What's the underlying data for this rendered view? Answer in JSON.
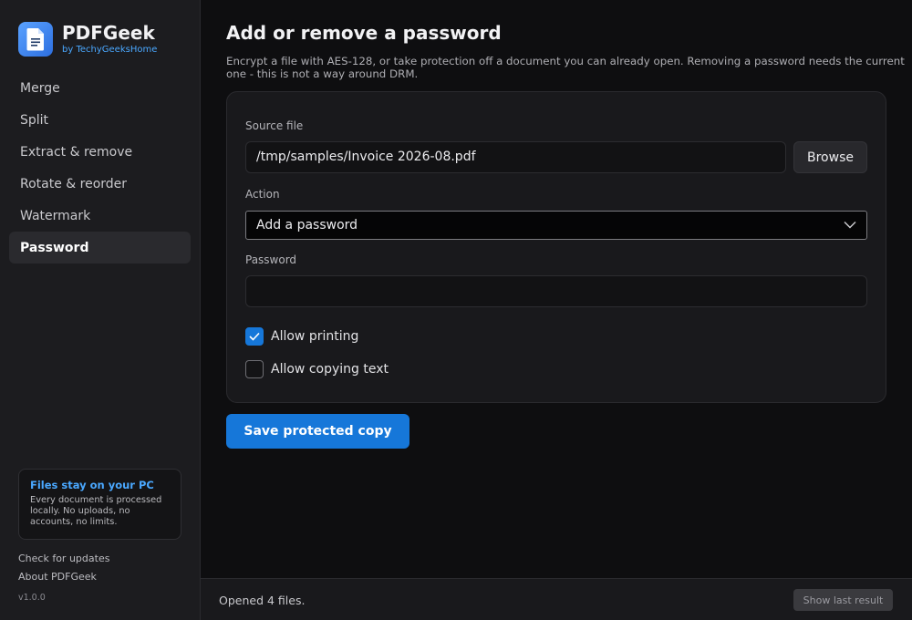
{
  "brand": {
    "name": "PDFGeek",
    "subtitle": "by TechyGeeksHome",
    "icon": "document-icon"
  },
  "sidebar": {
    "items": [
      {
        "label": "Merge",
        "active": false
      },
      {
        "label": "Split",
        "active": false
      },
      {
        "label": "Extract & remove",
        "active": false
      },
      {
        "label": "Rotate & reorder",
        "active": false
      },
      {
        "label": "Watermark",
        "active": false
      },
      {
        "label": "Password",
        "active": true
      }
    ],
    "privacy": {
      "title": "Files stay on your PC",
      "body": "Every document is processed locally. No uploads, no accounts, no limits."
    },
    "check_updates": "Check for updates",
    "about": "About PDFGeek",
    "version": "v1.0.0"
  },
  "main": {
    "title": "Add or remove a password",
    "description_line1": "Encrypt a file with AES-128, or take protection off a document you can already open. Removing a password needs the current",
    "description_line2": "one - this is not a way around DRM.",
    "source_label": "Source file",
    "source_value": "/tmp/samples/Invoice 2026-08.pdf",
    "browse_label": "Browse",
    "action_label": "Action",
    "action_value": "Add a password",
    "password_label": "Password",
    "password_value": "",
    "allow_printing": {
      "label": "Allow printing",
      "checked": true
    },
    "allow_copying": {
      "label": "Allow copying text",
      "checked": false
    },
    "save_label": "Save protected copy"
  },
  "status": {
    "text": "Opened 4 files.",
    "button": "Show last result"
  },
  "colors": {
    "accent": "#1677d9",
    "brand_link": "#4aa8ff",
    "background": "#0e0e10",
    "sidebar": "#1c1c1f"
  }
}
